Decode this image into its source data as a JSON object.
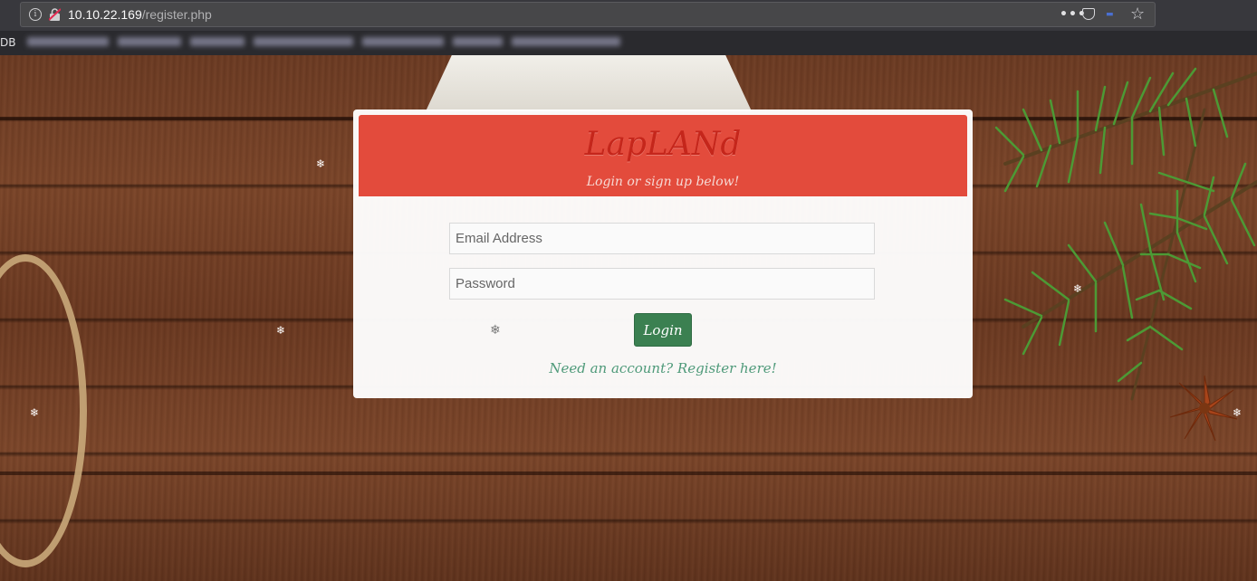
{
  "browser": {
    "url_host": "10.10.22.169",
    "url_path": "/register.php",
    "more_label": "•••",
    "bookmarks_prefix": "DB"
  },
  "page": {
    "brand": "LapLANd",
    "subtitle": "Login or sign up below!",
    "email_placeholder": "Email Address",
    "password_placeholder": "Password",
    "login_label": "Login",
    "register_link": "Need an account? Register here!"
  },
  "colors": {
    "header_red": "#e34b3c",
    "brand_text": "#c5261b",
    "login_green": "#3b8051",
    "link_green": "#4f9a7a"
  },
  "icons": [
    "info-icon",
    "insecure-lock-icon",
    "more-icon",
    "pocket-icon",
    "extension-icon",
    "bookmark-star-icon",
    "snowflake-icon"
  ]
}
